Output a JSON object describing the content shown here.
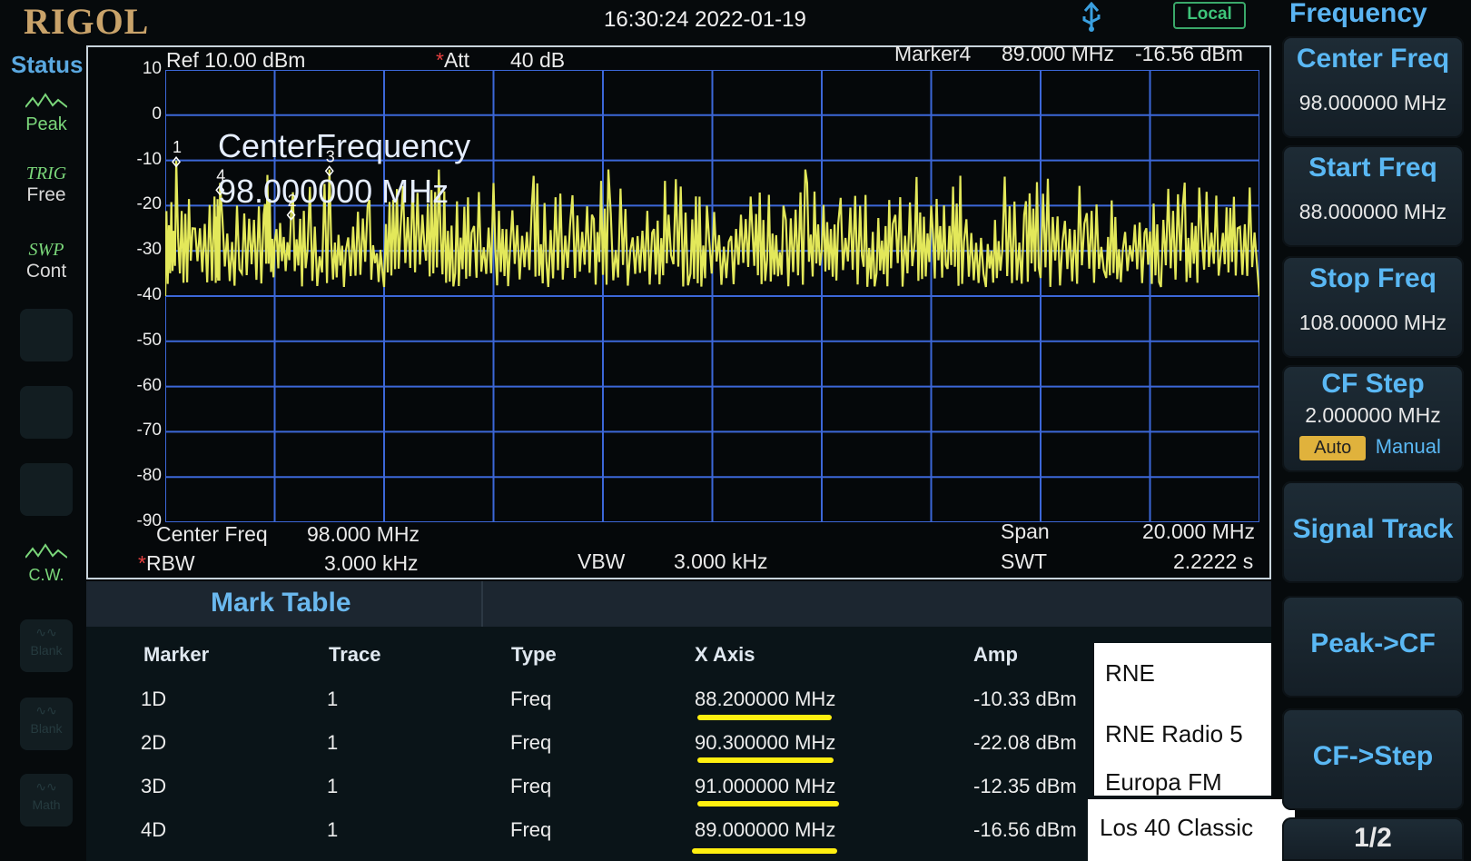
{
  "header": {
    "brand": "RIGOL",
    "datetime": "16:30:24 2022-01-19",
    "local_badge": "Local"
  },
  "status": {
    "title": "Status",
    "items": [
      {
        "top": "Peak"
      },
      {
        "top": "TRIG",
        "bottom": "Free"
      },
      {
        "top": "SWP",
        "bottom": "Cont"
      },
      {
        "top": "C.W."
      },
      {
        "top": "Blank"
      },
      {
        "top": "Blank"
      },
      {
        "top": "Math"
      }
    ]
  },
  "screen": {
    "ref": "Ref  10.00 dBm",
    "att_label": "Att",
    "att_value": "40 dB",
    "marker_readout_label": "Marker4",
    "marker_readout_freq": "89.000 MHz",
    "marker_readout_amp": "-16.56 dBm",
    "cf_overlay_line1": "CenterFrequency",
    "cf_overlay_line2": "98.000000 MHz",
    "center_freq_label": "Center Freq",
    "center_freq_value": "98.000 MHz",
    "rbw_label": "RBW",
    "rbw_value": "3.000 kHz",
    "vbw_label": "VBW",
    "vbw_value": "3.000 kHz",
    "span_label": "Span",
    "span_value": "20.000 MHz",
    "swt_label": "SWT",
    "swt_value": "2.2222 s"
  },
  "chart_data": {
    "type": "line",
    "xlabel": "",
    "ylabel": "",
    "x_range_mhz": [
      88.0,
      108.0
    ],
    "ylim": [
      -90,
      10
    ],
    "y_ticks": [
      "10",
      "0",
      "-10",
      "-20",
      "-30",
      "-40",
      "-50",
      "-60",
      "-70",
      "-80",
      "-90"
    ],
    "grid": true,
    "series": [
      {
        "color": "#e3e85a",
        "x": [
          88.0,
          88.2,
          88.5,
          88.9,
          89.0,
          89.4,
          89.8,
          90.0,
          90.3,
          90.6,
          91.0,
          91.3,
          91.7,
          92.0,
          92.3,
          92.7,
          93.0,
          93.3,
          93.6,
          94.0,
          94.3,
          94.7,
          95.0,
          95.4,
          95.8,
          96.1,
          96.5,
          96.9,
          97.2,
          97.6,
          97.9,
          98.3,
          98.7,
          99.0,
          99.3,
          99.7,
          100.0,
          100.3,
          100.7,
          101.0,
          101.3,
          101.7,
          102.0,
          102.3,
          102.6,
          103.0,
          103.3,
          103.7,
          104.0,
          104.4,
          104.8,
          105.2,
          105.5,
          105.9,
          106.2,
          106.6,
          106.9,
          107.3,
          107.6,
          108.0
        ],
        "values": [
          -40,
          -10,
          -25,
          -18,
          -15,
          -35,
          -22,
          -28,
          -22,
          -30,
          -12,
          -30,
          -20,
          -38,
          -25,
          -22,
          -12,
          -35,
          -26,
          -15,
          -30,
          -20,
          -38,
          -24,
          -22,
          -12,
          -30,
          -26,
          -22,
          -35,
          -20,
          -28,
          -18,
          -32,
          -20,
          -12,
          -30,
          -24,
          -20,
          -35,
          -24,
          -28,
          -20,
          -34,
          -28,
          -38,
          -30,
          -22,
          -36,
          -28,
          -24,
          -36,
          -30,
          -26,
          -38,
          -20,
          -16,
          -30,
          -25,
          -40
        ]
      }
    ],
    "markers": [
      {
        "label": "1",
        "x": 88.2,
        "y": -10.33
      },
      {
        "label": "2",
        "x": 90.3,
        "y": -22.08
      },
      {
        "label": "3",
        "x": 91.0,
        "y": -12.35
      },
      {
        "label": "4",
        "x": 89.0,
        "y": -16.56
      }
    ]
  },
  "mark_table": {
    "title": "Mark Table",
    "headers": {
      "marker": "Marker",
      "trace": "Trace",
      "type": "Type",
      "x_axis": "X Axis",
      "amp": "Amp"
    },
    "rows": [
      {
        "marker": "1D",
        "trace": "1",
        "type": "Freq",
        "x_axis": "88.200000 MHz",
        "amp": "-10.33 dBm",
        "note": "RNE"
      },
      {
        "marker": "2D",
        "trace": "1",
        "type": "Freq",
        "x_axis": "90.300000 MHz",
        "amp": "-22.08 dBm",
        "note": "RNE Radio 5"
      },
      {
        "marker": "3D",
        "trace": "1",
        "type": "Freq",
        "x_axis": "91.000000 MHz",
        "amp": "-12.35 dBm",
        "note": "Europa FM"
      },
      {
        "marker": "4D",
        "trace": "1",
        "type": "Freq",
        "x_axis": "89.000000 MHz",
        "amp": "-16.56 dBm",
        "note": "Los 40 Classic"
      }
    ]
  },
  "softkeys": {
    "title": "Frequency",
    "center_freq": {
      "label": "Center Freq",
      "value": "98.000000 MHz"
    },
    "start_freq": {
      "label": "Start Freq",
      "value": "88.000000 MHz"
    },
    "stop_freq": {
      "label": "Stop Freq",
      "value": "108.00000 MHz"
    },
    "cf_step": {
      "label": "CF Step",
      "value": "2.000000 MHz",
      "auto": "Auto",
      "manual": "Manual"
    },
    "signal_track": {
      "label": "Signal Track"
    },
    "peak_cf": {
      "label": "Peak->CF"
    },
    "cf_step_btn": {
      "label": "CF->Step"
    },
    "page": {
      "label": "1/2"
    }
  },
  "colors": {
    "trace": "#e3e85a",
    "grid": "#3c67d8",
    "accent": "#5ab8f4",
    "underline": "#ffef10"
  }
}
